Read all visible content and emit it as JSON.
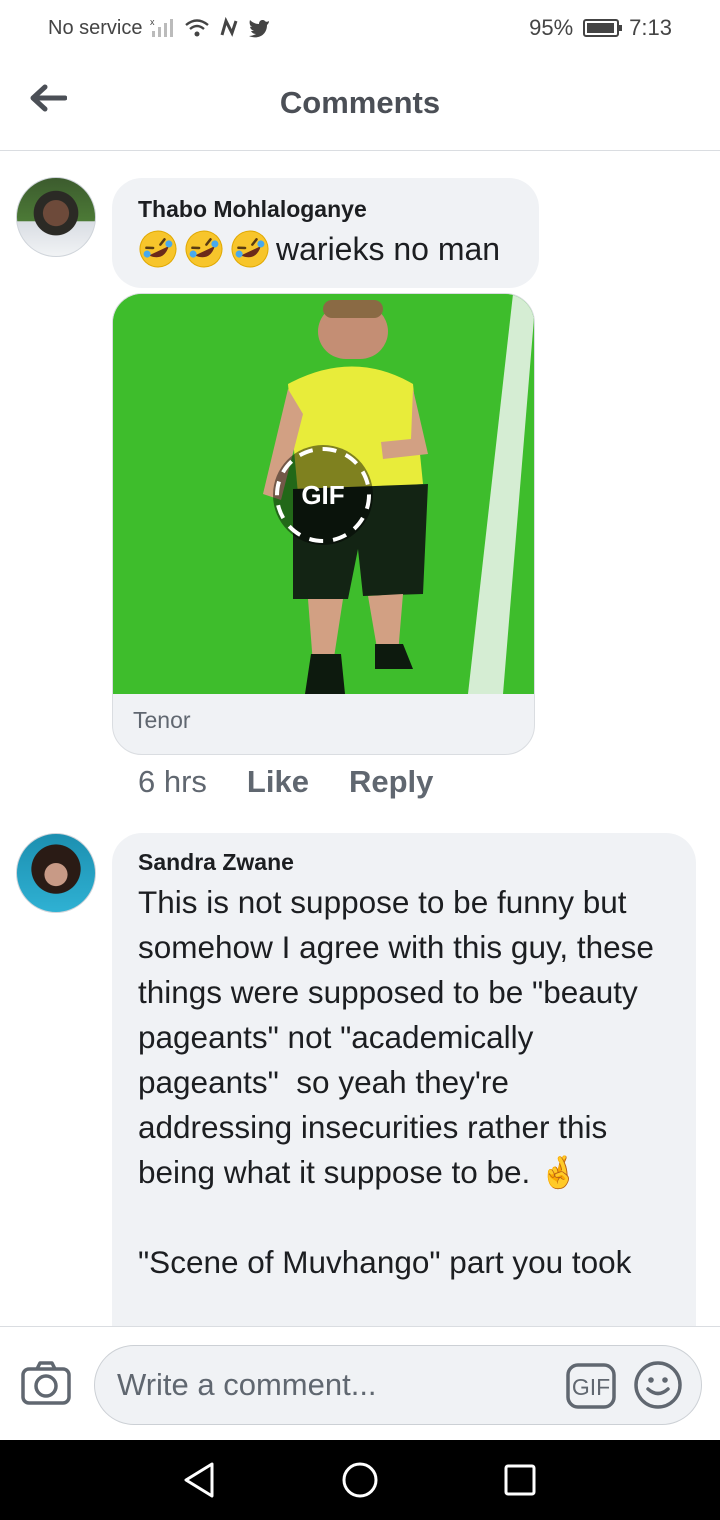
{
  "status_bar": {
    "carrier": "No service",
    "battery": "95%",
    "battery_level": 0.95,
    "time": "7:13"
  },
  "header": {
    "title": "Comments",
    "back_icon": "arrow-left-icon"
  },
  "comments": [
    {
      "author": "Thabo Mohlaloganye",
      "emoji_prefix": [
        "rolling-on-floor-laughing",
        "rolling-on-floor-laughing",
        "rolling-on-floor-laughing"
      ],
      "text": "warieks no man",
      "attachment": {
        "type": "gif",
        "badge": "GIF",
        "source": "Tenor"
      },
      "time": "6 hrs",
      "like_label": "Like",
      "reply_label": "Reply"
    },
    {
      "author": "Sandra Zwane",
      "text": "This is not suppose to be funny but somehow I agree with this guy, these things were supposed to be \"beauty pageants\" not \"academically pageants\"  so yeah they're addressing insecurities rather this being what it suppose to be. 🤞\n\n\"Scene of Muvhango\" part you took"
    }
  ],
  "composer": {
    "placeholder": "Write a comment...",
    "camera_icon": "camera-icon",
    "gif_label": "GIF",
    "emoji_icon": "smiley-icon"
  },
  "nav_bar": {
    "back_icon": "triangle-back-icon",
    "home_icon": "circle-home-icon",
    "recents_icon": "square-recents-icon"
  },
  "colors": {
    "bubble_bg": "#f0f2f5",
    "secondary_text": "#606770",
    "gif_green": "#3ebd2c"
  }
}
